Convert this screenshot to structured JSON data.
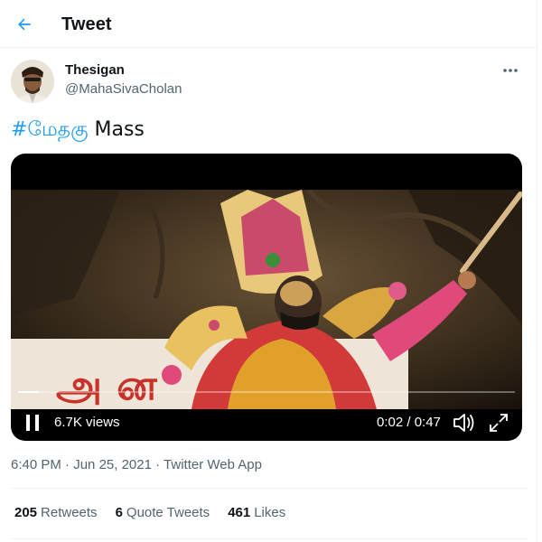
{
  "header": {
    "title": "Tweet",
    "back_icon": "arrow-left-icon"
  },
  "author": {
    "name": "Thesigan",
    "handle": "@MahaSivaCholan",
    "more_icon": "more-horizontal-icon"
  },
  "tweet": {
    "hashtag": "#மேதகு",
    "text": " Mass"
  },
  "video": {
    "views": "6.7K views",
    "time": "0:02 / 0:47",
    "progress": 0.042,
    "play_state_icon": "pause-icon",
    "volume_icon": "volume-icon",
    "fullscreen_icon": "fullscreen-icon",
    "banner_text": "அ ன"
  },
  "meta": {
    "time": "6:40 PM",
    "date": "Jun 25, 2021",
    "source": "Twitter Web App",
    "separator": " · "
  },
  "stats": {
    "retweets_count": "205",
    "retweets_label": "Retweets",
    "quotes_count": "6",
    "quotes_label": "Quote Tweets",
    "likes_count": "461",
    "likes_label": "Likes"
  },
  "colors": {
    "accent": "#1d9bf0",
    "text": "#0f1419",
    "secondary": "#536471",
    "border": "#eff3f4"
  }
}
